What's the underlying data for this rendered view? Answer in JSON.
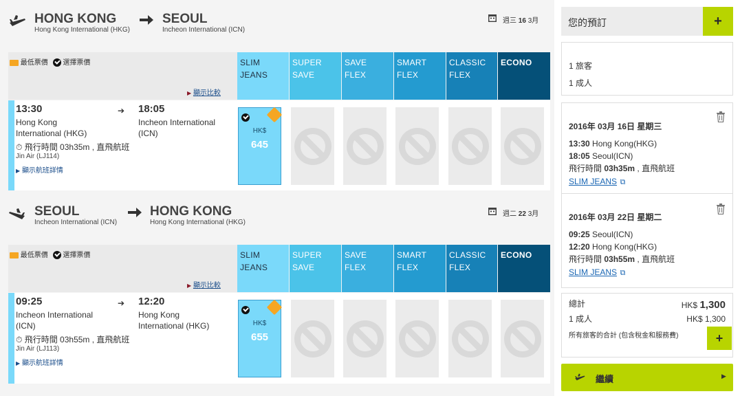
{
  "outbound": {
    "from_city": "HONG KONG",
    "from_airport": "Hong Kong International (HKG)",
    "to_city": "SEOUL",
    "to_airport": "Incheon International (ICN)",
    "date_weekday": "週三",
    "date_day": "16",
    "date_month": "3月",
    "legend_lowest": "最低票價",
    "legend_selected": "選擇票價",
    "compare_link": "顯示比較",
    "fares": [
      {
        "line1": "SLIM",
        "line2": "JEANS"
      },
      {
        "line1": "SUPER",
        "line2": "SAVE"
      },
      {
        "line1": "SAVE FLEX",
        "line2": ""
      },
      {
        "line1": "SMART",
        "line2": "FLEX"
      },
      {
        "line1": "CLASSIC",
        "line2": "FLEX"
      },
      {
        "line1": "ECONO",
        "line2": ""
      }
    ],
    "flight": {
      "depart_time": "13:30",
      "depart_place_1": "Hong Kong",
      "depart_place_2": "International (HKG)",
      "arrive_time": "18:05",
      "arrive_place_1": "Incheon International",
      "arrive_place_2": "(ICN)",
      "duration": "飛行時間 03h35m , 直飛航班",
      "flight_code": "Jin Air (LJ114)",
      "details_link": "顯示航班詳情",
      "selected_currency": "HK$",
      "selected_price": "645"
    }
  },
  "inbound": {
    "from_city": "SEOUL",
    "from_airport": "Incheon International (ICN)",
    "to_city": "HONG KONG",
    "to_airport": "Hong Kong International (HKG)",
    "date_weekday": "週二",
    "date_day": "22",
    "date_month": "3月",
    "legend_lowest": "最低票價",
    "legend_selected": "選擇票價",
    "compare_link": "顯示比較",
    "fares": [
      {
        "line1": "SLIM",
        "line2": "JEANS"
      },
      {
        "line1": "SUPER",
        "line2": "SAVE"
      },
      {
        "line1": "SAVE FLEX",
        "line2": ""
      },
      {
        "line1": "SMART",
        "line2": "FLEX"
      },
      {
        "line1": "CLASSIC",
        "line2": "FLEX"
      },
      {
        "line1": "ECONO",
        "line2": ""
      }
    ],
    "flight": {
      "depart_time": "09:25",
      "depart_place_1": "Incheon International",
      "depart_place_2": "(ICN)",
      "arrive_time": "12:20",
      "arrive_place_1": "Hong Kong",
      "arrive_place_2": "International (HKG)",
      "duration": "飛行時間 03h55m , 直飛航班",
      "flight_code": "Jin Air (LJ113)",
      "details_link": "顯示航班詳情",
      "selected_currency": "HK$",
      "selected_price": "655"
    }
  },
  "sidebar": {
    "title": "您的預訂",
    "passengers_line1": "1 旅客",
    "passengers_line2": "1 成人",
    "leg1": {
      "date": "2016年 03月 16日 星期三",
      "dep_time": "13:30",
      "dep_place": "Hong Kong(HKG)",
      "arr_time": "18:05",
      "arr_place": "Seoul(ICN)",
      "duration_label": "飛行時間",
      "duration_value": "03h35m",
      "direct": ", 直飛航班",
      "fare_link": "SLIM JEANS"
    },
    "leg2": {
      "date": "2016年 03月 22日 星期二",
      "dep_time": "09:25",
      "dep_place": "Seoul(ICN)",
      "arr_time": "12:20",
      "arr_place": "Hong Kong(HKG)",
      "duration_label": "飛行時間",
      "duration_value": "03h55m",
      "direct": ", 直飛航班",
      "fare_link": "SLIM JEANS"
    },
    "total_label": "總計",
    "total_currency": "HK$",
    "total_value": "1,300",
    "adult_label": "1 成人",
    "adult_value": "HK$ 1,300",
    "total_note": "所有旅客的合計 (包含稅金和服務費)",
    "continue_label": "繼續"
  },
  "colors": {
    "accent_green": "#b8d400",
    "slim_jeans": "#7ad9fa",
    "econo": "#055078"
  }
}
